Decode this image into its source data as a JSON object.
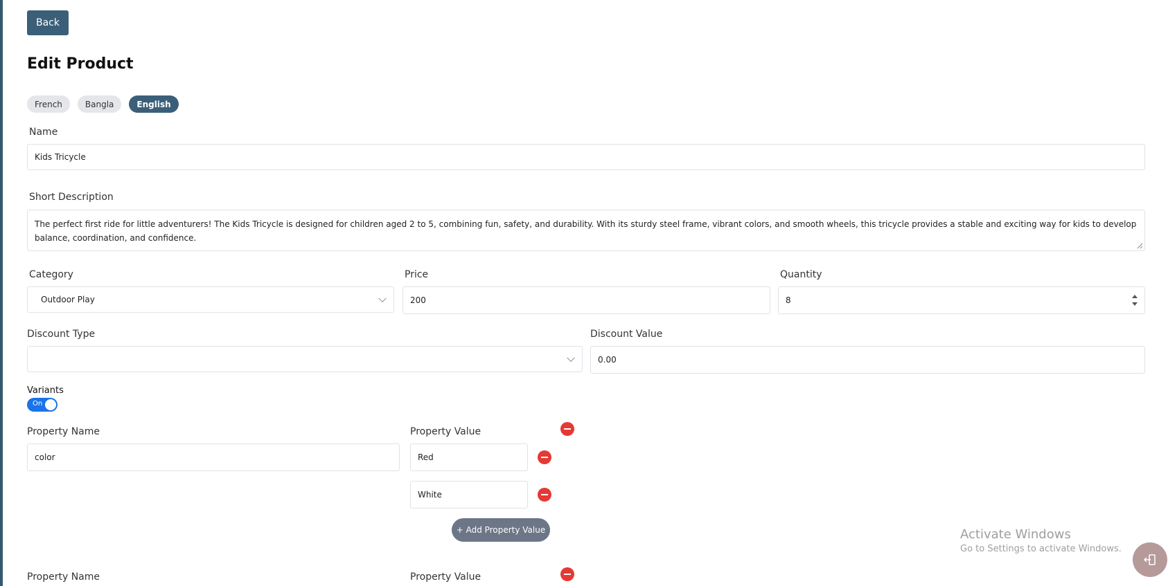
{
  "header": {
    "back_label": "Back",
    "title": "Edit Product"
  },
  "languages": [
    {
      "label": "French",
      "active": false
    },
    {
      "label": "Bangla",
      "active": false
    },
    {
      "label": "English",
      "active": true
    }
  ],
  "form": {
    "name_label": "Name",
    "name_value": "Kids Tricycle",
    "short_description_label": "Short Description",
    "short_description_value": "The perfect first ride for little adventurers! The Kids Tricycle is designed for children aged 2 to 5, combining fun, safety, and durability. With its sturdy steel frame, vibrant colors, and smooth wheels, this tricycle provides a stable and exciting way for kids to develop balance, coordination, and confidence.",
    "category_label": "Category",
    "category_value": "Outdoor Play",
    "price_label": "Price",
    "price_value": "200",
    "quantity_label": "Quantity",
    "quantity_value": "8",
    "discount_type_label": "Discount Type",
    "discount_type_value": "",
    "discount_value_label": "Discount Value",
    "discount_value_value": "0.00"
  },
  "variants": {
    "label": "Variants",
    "toggle_text": "On",
    "enabled": true,
    "property_name_label": "Property Name",
    "property_value_label": "Property Value",
    "groups": [
      {
        "name": "color",
        "values": [
          "Red",
          "White"
        ]
      }
    ],
    "add_value_label": "+ Add Property Value"
  },
  "watermark": {
    "title": "Activate Windows",
    "subtitle": "Go to Settings to activate Windows."
  },
  "colors": {
    "primary": "#3b5f78",
    "danger": "#e53935",
    "toggle": "#1a73e8",
    "fab": "#b69a9a"
  },
  "icons": {
    "remove": "remove-circle-icon",
    "chevron": "chevron-down-icon",
    "logout": "logout-icon"
  }
}
